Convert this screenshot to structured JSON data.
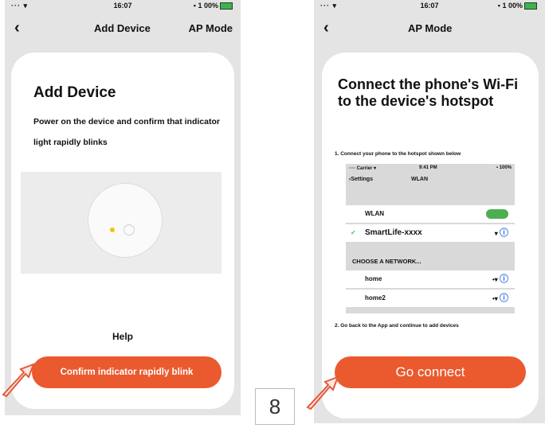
{
  "left_screen": {
    "status": {
      "signal": "··· ▾",
      "time": "16:07",
      "battery": "▪ 1 00%"
    },
    "nav": {
      "back_icon": "chevron-left-icon",
      "title": "Add Device",
      "right_action": "AP Mode"
    },
    "heading": "Add Device",
    "instruction": "Power on the device and confirm that indicator light rapidly blinks",
    "help_label": "Help",
    "confirm_button": "Confirm indicator rapidly blink"
  },
  "right_screen": {
    "status": {
      "signal": "··· ▾",
      "time": "16:07",
      "battery": "▪ 1 00%"
    },
    "nav": {
      "back_icon": "chevron-left-icon",
      "title": "AP Mode"
    },
    "heading": "Connect the phone's Wi-Fi to the device's hotspot",
    "step1": "1. Connect your phone to the hotspot shown below",
    "wifi_settings": {
      "status_left": "···· Carrier ▾",
      "status_time": "9:41 PM",
      "status_right": "▪ 100%",
      "back_label": "Settings",
      "title": "WLAN",
      "wlan_label": "WLAN",
      "connected_network": "SmartLife-xxxx",
      "choose_network_label": "CHOOSE A NETWORK...",
      "networks": [
        "home",
        "home2"
      ]
    },
    "step2": "2. Go back to the App and continue to add devices",
    "connect_button": "Go connect"
  },
  "page_number": "8",
  "colors": {
    "accent": "#ea5a2e",
    "toggle_on": "#4caf50",
    "info": "#2f6fd9",
    "led": "#f5c400"
  }
}
